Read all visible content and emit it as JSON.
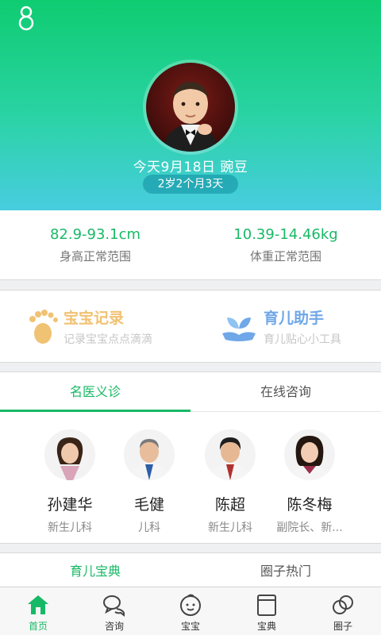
{
  "header": {
    "date_name": "今天9月18日 豌豆",
    "age": "2岁2个月3天"
  },
  "stats": {
    "height_range": "82.9-93.1cm",
    "height_label": "身高正常范围",
    "weight_range": "10.39-14.46kg",
    "weight_label": "体重正常范围"
  },
  "tools": [
    {
      "title": "宝宝记录",
      "subtitle": "记录宝宝点点滴滴",
      "icon": "footprint-icon",
      "color": "#f0c273"
    },
    {
      "title": "育儿助手",
      "subtitle": "育儿贴心小工具",
      "icon": "leaf-hand-icon",
      "color": "#6fa7e8"
    }
  ],
  "doctor_tabs": [
    "名医义诊",
    "在线咨询"
  ],
  "doctors": [
    {
      "name": "孙建华",
      "dept": "新生儿科"
    },
    {
      "name": "毛健",
      "dept": "儿科"
    },
    {
      "name": "陈超",
      "dept": "新生儿科"
    },
    {
      "name": "陈冬梅",
      "dept": "副院长、新..."
    }
  ],
  "bottom_tabs": [
    "育儿宝典",
    "圈子热门"
  ],
  "tabbar": [
    {
      "label": "首页",
      "icon": "home-icon"
    },
    {
      "label": "咨询",
      "icon": "chat-icon"
    },
    {
      "label": "宝宝",
      "icon": "baby-face-icon"
    },
    {
      "label": "宝典",
      "icon": "book-icon"
    },
    {
      "label": "圈子",
      "icon": "circles-icon"
    }
  ],
  "colors": {
    "accent": "#18b966",
    "header_top": "#0fcc71",
    "header_bottom": "#48cde0"
  }
}
